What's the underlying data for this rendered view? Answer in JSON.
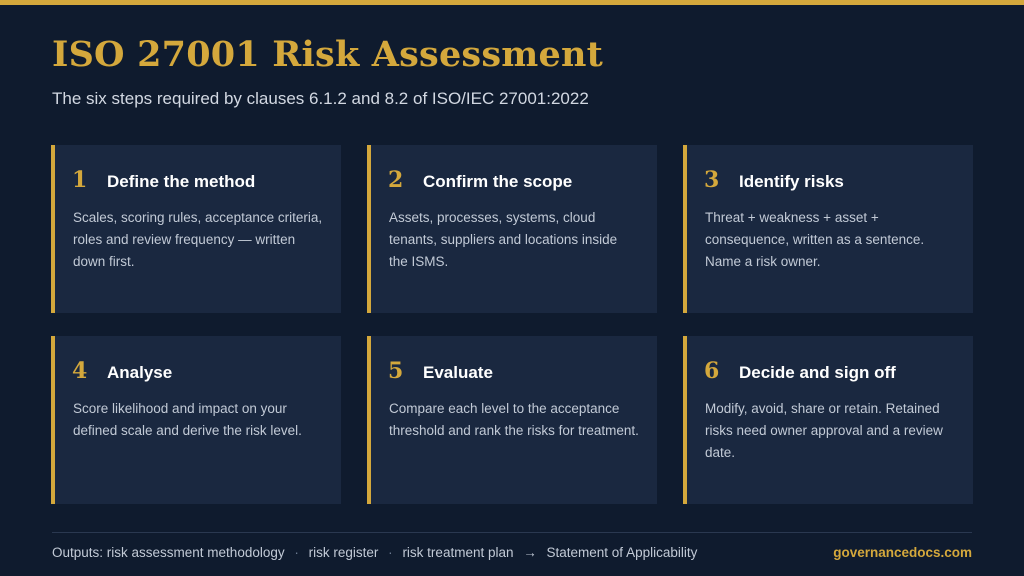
{
  "title": "ISO 27001 Risk Assessment",
  "subtitle": "The six steps required by clauses 6.1.2 and 8.2 of ISO/IEC 27001:2022",
  "accent_color": "#d4a83c",
  "background_color": "#0f1b2e",
  "steps": [
    {
      "number": "1",
      "heading": "Define the method",
      "body": "Scales, scoring rules, acceptance criteria, roles and review frequency — written down first."
    },
    {
      "number": "2",
      "heading": "Confirm the scope",
      "body": "Assets, processes, systems, cloud tenants, suppliers and locations inside the ISMS."
    },
    {
      "number": "3",
      "heading": "Identify risks",
      "body": "Threat + weakness + asset + consequence, written as a sentence. Name a risk owner."
    },
    {
      "number": "4",
      "heading": "Analyse",
      "body": "Score likelihood and impact on your defined scale and derive the risk level."
    },
    {
      "number": "5",
      "heading": "Evaluate",
      "body": "Compare each level to the acceptance threshold and rank the risks for treatment."
    },
    {
      "number": "6",
      "heading": "Decide and sign off",
      "body": "Modify, avoid, share or retain. Retained risks need owner approval and a review date."
    }
  ],
  "footer": {
    "outputs_label": "Outputs: risk assessment methodology",
    "separator": "·",
    "item_2": "risk register",
    "item_3": "risk treatment plan",
    "arrow": "→",
    "item_4": "Statement of Applicability",
    "brand": "governancedocs.com"
  }
}
